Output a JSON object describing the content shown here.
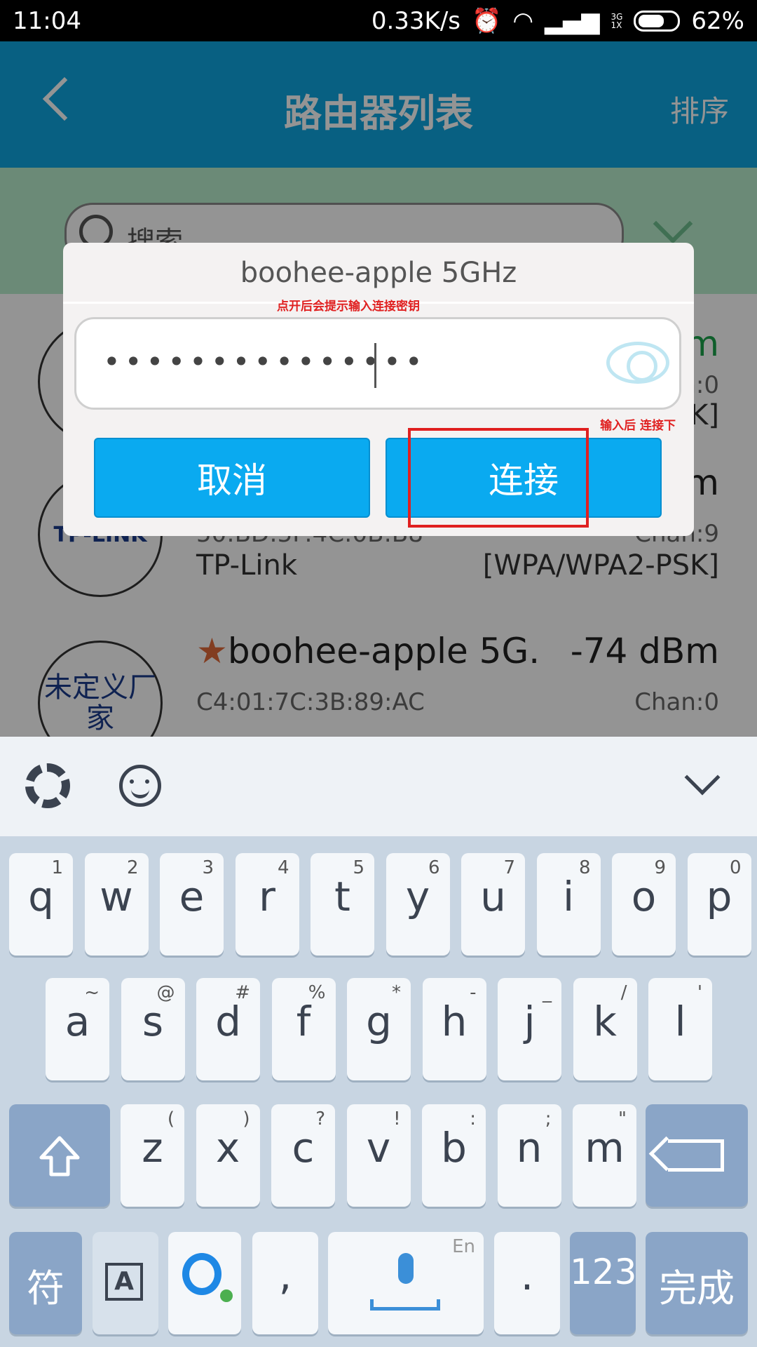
{
  "status_bar": {
    "time": "11:04",
    "speed": "0.33K/s",
    "net_top": "3G",
    "net_bottom": "1X",
    "battery": "62%"
  },
  "app": {
    "title": "路由器列表",
    "sort_label": "排序",
    "search_placeholder": "搜索"
  },
  "list": [
    {
      "ssid": "",
      "dbm": "m",
      "mac": "",
      "chan": "n:0",
      "security": "K]",
      "logo": ""
    },
    {
      "ssid": "",
      "dbm": "m",
      "mac": "50:BD:5F:4C:0B:B8",
      "chan": "Chan:9",
      "vendor": "TP-Link",
      "security": "[WPA/WPA2-PSK]",
      "logo": "TP-LINK"
    },
    {
      "ssid": "boohee-apple 5G.",
      "star": "★",
      "dbm": "-74 dBm",
      "mac": "C4:01:7C:3B:89:AC",
      "chan": "Chan:0",
      "logo": "未定义厂家"
    }
  ],
  "dialog": {
    "title": "boohee-apple 5GHz",
    "annotation_top": "点开后会提示输入连接密钥",
    "password_mask": "•••••••••••••••",
    "annotation_right": "输入后 连接下",
    "cancel_label": "取消",
    "connect_label": "连接"
  },
  "keyboard": {
    "row1": [
      {
        "k": "q",
        "s": "1"
      },
      {
        "k": "w",
        "s": "2"
      },
      {
        "k": "e",
        "s": "3"
      },
      {
        "k": "r",
        "s": "4"
      },
      {
        "k": "t",
        "s": "5"
      },
      {
        "k": "y",
        "s": "6"
      },
      {
        "k": "u",
        "s": "7"
      },
      {
        "k": "i",
        "s": "8"
      },
      {
        "k": "o",
        "s": "9"
      },
      {
        "k": "p",
        "s": "0"
      }
    ],
    "row2": [
      {
        "k": "a",
        "s": "~"
      },
      {
        "k": "s",
        "s": "@"
      },
      {
        "k": "d",
        "s": "#"
      },
      {
        "k": "f",
        "s": "%"
      },
      {
        "k": "g",
        "s": "*"
      },
      {
        "k": "h",
        "s": "-"
      },
      {
        "k": "j",
        "s": "_"
      },
      {
        "k": "k",
        "s": "/"
      },
      {
        "k": "l",
        "s": "'"
      }
    ],
    "row3": [
      {
        "k": "z",
        "s": "("
      },
      {
        "k": "x",
        "s": ")"
      },
      {
        "k": "c",
        "s": "?"
      },
      {
        "k": "v",
        "s": "!"
      },
      {
        "k": "b",
        "s": ":"
      },
      {
        "k": "n",
        "s": ";"
      },
      {
        "k": "m",
        "s": "\""
      }
    ],
    "symbol_key": "符",
    "comma_key": ",",
    "space_hint": "En",
    "period_key": ".",
    "num_key": "123",
    "done_key": "完成",
    "switch_key": "A"
  }
}
